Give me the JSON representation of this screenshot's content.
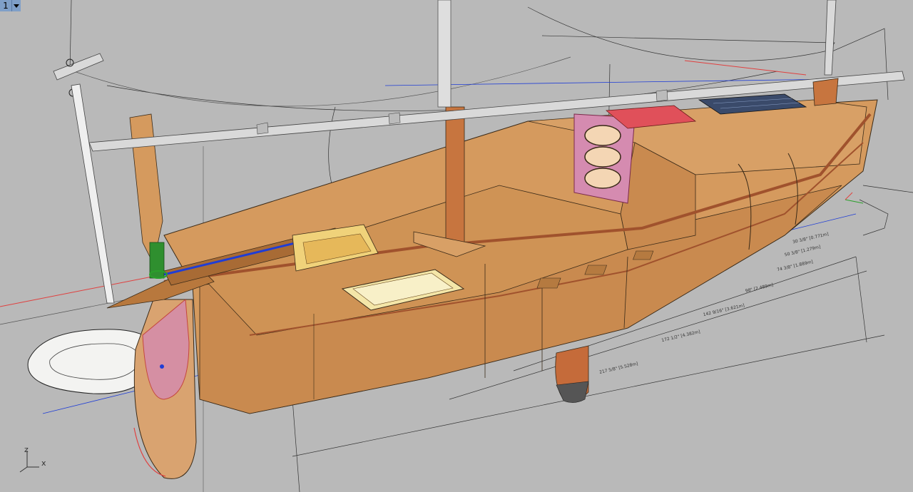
{
  "viewport": {
    "number": "1",
    "axis_labels": {
      "z": "z",
      "x": "x"
    }
  },
  "dimensions": [
    "30 3/8\" [0.771m]",
    "50 3/8\" [1.279m]",
    "74 3/8\" [1.889m]",
    "98\" [2.489m]",
    "142 9/16\" [3.621m]",
    "172 1/2\" [4.382m]",
    "217 5/8\" [5.528m]"
  ],
  "colors": {
    "background": "#b9b9b9",
    "hull": "#d59a5e",
    "hull_dark": "#b9773f",
    "trim": "#a0522d",
    "selection_red": "#e0403f",
    "selection_blue": "#1f3dd6"
  }
}
